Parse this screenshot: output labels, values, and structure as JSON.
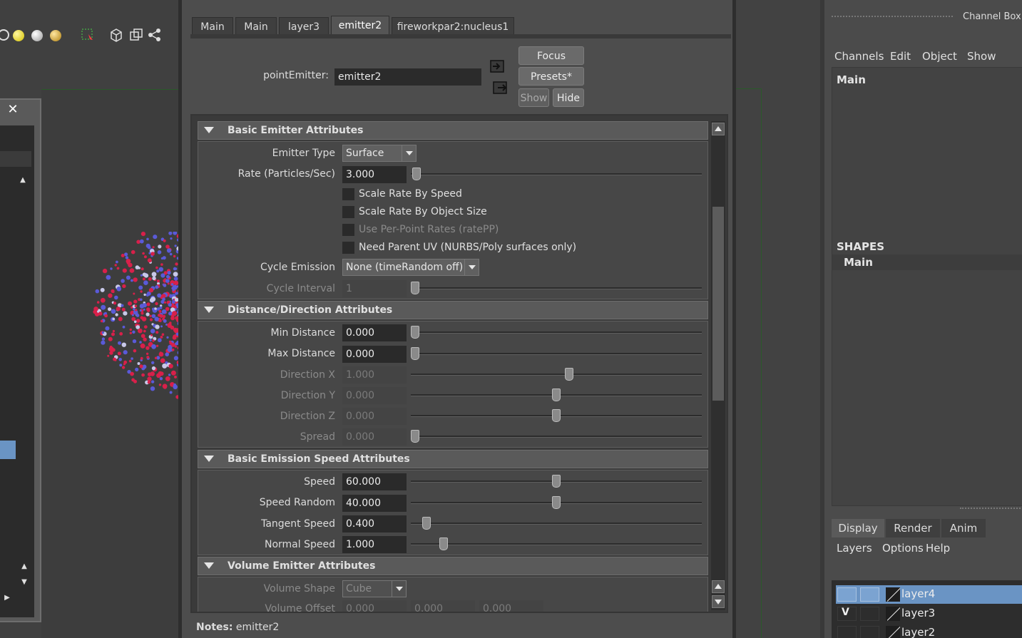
{
  "attribute_editor": {
    "tabs": [
      "Main",
      "Main",
      "layer3",
      "emitter2",
      "fireworkpar2:nucleus1"
    ],
    "active_tab": "emitter2",
    "node_type_label": "pointEmitter:",
    "node_name": "emitter2",
    "buttons": {
      "focus": "Focus",
      "presets": "Presets*",
      "show": "Show",
      "hide": "Hide"
    },
    "notes_label": "Notes:",
    "notes_value": "emitter2",
    "basic": {
      "title": "Basic Emitter Attributes",
      "emitter_type_label": "Emitter Type",
      "emitter_type_value": "Surface",
      "rate_label": "Rate (Particles/Sec)",
      "rate_value": "3.000",
      "chk_scale_speed": "Scale Rate By Speed",
      "chk_scale_size": "Scale Rate By Object Size",
      "chk_per_point": "Use Per-Point Rates (ratePP)",
      "chk_parent_uv": "Need Parent UV (NURBS/Poly surfaces only)",
      "cycle_emission_label": "Cycle Emission",
      "cycle_emission_value": "None (timeRandom off)",
      "cycle_interval_label": "Cycle Interval",
      "cycle_interval_value": "1"
    },
    "distance": {
      "title": "Distance/Direction Attributes",
      "min_label": "Min Distance",
      "min_value": "0.000",
      "max_label": "Max Distance",
      "max_value": "0.000",
      "dirx_label": "Direction X",
      "dirx_value": "1.000",
      "diry_label": "Direction Y",
      "diry_value": "0.000",
      "dirz_label": "Direction Z",
      "dirz_value": "0.000",
      "spread_label": "Spread",
      "spread_value": "0.000"
    },
    "speed": {
      "title": "Basic Emission Speed Attributes",
      "speed_label": "Speed",
      "speed_value": "60.000",
      "speed_random_label": "Speed Random",
      "speed_random_value": "40.000",
      "tangent_label": "Tangent Speed",
      "tangent_value": "0.400",
      "normal_label": "Normal Speed",
      "normal_value": "1.000"
    },
    "volume": {
      "title": "Volume Emitter Attributes",
      "shape_label": "Volume Shape",
      "shape_value": "Cube",
      "offset_label": "Volume Offset",
      "offset_values": [
        "0.000",
        "0.000",
        "0.000"
      ]
    }
  },
  "channel_box": {
    "title": "Channel Box /",
    "menus": [
      "Channels",
      "Edit",
      "Object",
      "Show"
    ],
    "node_main": "Main",
    "shapes_header": "SHAPES",
    "shape_main": "Main"
  },
  "layer_editor": {
    "tabs": [
      "Display",
      "Render",
      "Anim"
    ],
    "active_tab": "Display",
    "menus": [
      "Layers",
      "Options",
      "Help"
    ],
    "layers": [
      {
        "name": "layer4",
        "visible": "",
        "selected": true
      },
      {
        "name": "layer3",
        "visible": "V",
        "selected": false
      },
      {
        "name": "layer2",
        "visible": "",
        "selected": false
      }
    ]
  },
  "float_panel": {
    "close": "✕"
  },
  "colors": {
    "accent_selection": "#6a94c4",
    "panel_bg": "#4d4d4d",
    "field_bg": "#2a2a2a"
  },
  "icons": [
    "render-settings-icon",
    "light-yellow-icon",
    "light-white-icon",
    "light-gold-icon",
    "select-region-icon",
    "cube-icon",
    "duplicate-icon",
    "graph-icon"
  ]
}
